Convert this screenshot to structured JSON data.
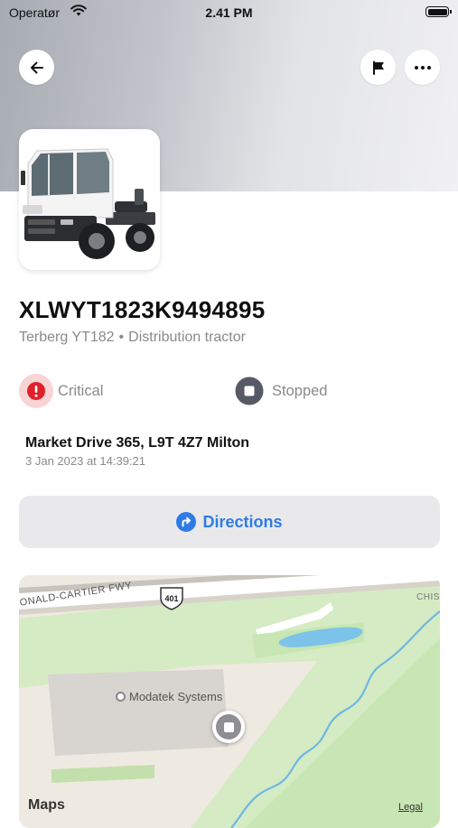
{
  "status_bar": {
    "carrier": "Operatør",
    "time": "2.41 PM",
    "wifi_icon": "wifi-icon",
    "battery_icon": "battery-icon"
  },
  "header": {
    "back_icon": "arrow-left-icon",
    "flag_icon": "flag-icon",
    "more_icon": "ellipsis-icon"
  },
  "vehicle": {
    "id": "XLWYT1823K9494895",
    "model": "Terberg YT182",
    "separator": "•",
    "type": "Distribution tractor",
    "image": "terberg-yard-tractor-photo"
  },
  "statuses": {
    "alert_label": "Critical",
    "alert_icon": "exclamation-circle-icon",
    "alert_color": "#e0212b",
    "engine_label": "Stopped",
    "engine_icon": "stop-square-icon",
    "engine_color": "#555a66"
  },
  "location": {
    "address": "Market Drive 365, L9T 4Z7 Milton",
    "timestamp": "3 Jan 2023 at 14:39:21"
  },
  "directions": {
    "label": "Directions",
    "icon": "turn-right-arrow-icon",
    "accent": "#2f7be6"
  },
  "map": {
    "highway_label": "ONALD-CARTIER FWY",
    "highway_shield": "401",
    "street_label": "CHIS",
    "poi_label": "Modatek Systems",
    "attribution": "Maps",
    "legal": "Legal"
  }
}
